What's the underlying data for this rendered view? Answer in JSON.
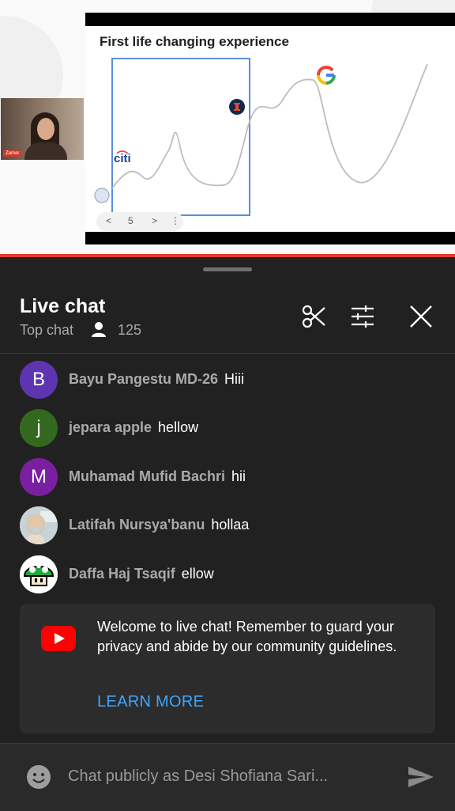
{
  "slide": {
    "title": "First life changing experience",
    "nav_prev": "<",
    "nav_page": "5",
    "nav_next": ">",
    "nav_more": "⋮",
    "citi_label": "citi",
    "webcam_name": "Zamar"
  },
  "header": {
    "title": "Live chat",
    "mode_label": "Top chat",
    "viewer_count": "125"
  },
  "messages": [
    {
      "avatar": "B",
      "avatar_color": "#5e35b1",
      "author": "Bayu Pangestu MD-26",
      "text": "Hiii"
    },
    {
      "avatar": "j",
      "avatar_color": "#33691e",
      "author": "jepara apple",
      "text": "hellow"
    },
    {
      "avatar": "M",
      "avatar_color": "#7b1fa2",
      "author": "Muhamad Mufid Bachri",
      "text": "hii"
    },
    {
      "avatar": "",
      "avatar_color": "#8fa7b3",
      "author": "Latifah Nursya'banu",
      "text": "hollaa"
    },
    {
      "avatar": "",
      "avatar_color": "#e8f5e9",
      "author": "Daffa Haj Tsaqif",
      "text": "ellow"
    }
  ],
  "welcome": {
    "text": "Welcome to live chat! Remember to guard your privacy and abide by our community guidelines.",
    "link": "LEARN MORE"
  },
  "input": {
    "placeholder": "Chat publicly as Desi Shofiana Sari..."
  },
  "icons": {
    "clip": "scissors-icon",
    "filter": "sliders-icon",
    "close": "close-icon",
    "viewer": "person-icon",
    "emoji": "emoji-icon",
    "send": "send-icon",
    "youtube": "youtube-logo-icon"
  },
  "colors": {
    "accent_link": "#3ea6ff",
    "youtube_red": "#ff0000",
    "progress_red": "#e53935",
    "panel_bg": "#212121"
  }
}
